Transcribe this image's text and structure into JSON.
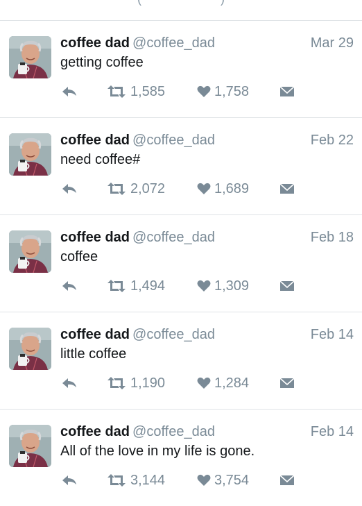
{
  "top_fragment": {
    "left": "(",
    "right": ")"
  },
  "colors": {
    "name": "#14171a",
    "meta": "#7a8a96",
    "divider": "#dfe3e6",
    "icon": "#7a8a96"
  },
  "tweets": [
    {
      "name": "coffee dad",
      "handle": "@coffee_dad",
      "date": "Mar 29",
      "text": "getting coffee",
      "retweets": "1,585",
      "likes": "1,758",
      "icons": [
        "reply-icon",
        "retweet-icon",
        "heart-icon",
        "envelope-icon"
      ]
    },
    {
      "name": "coffee dad",
      "handle": "@coffee_dad",
      "date": "Feb 22",
      "text": "need coffee#",
      "retweets": "2,072",
      "likes": "1,689",
      "icons": [
        "reply-icon",
        "retweet-icon",
        "heart-icon",
        "envelope-icon"
      ]
    },
    {
      "name": "coffee dad",
      "handle": "@coffee_dad",
      "date": "Feb 18",
      "text": "coffee",
      "retweets": "1,494",
      "likes": "1,309",
      "icons": [
        "reply-icon",
        "retweet-icon",
        "heart-icon",
        "envelope-icon"
      ]
    },
    {
      "name": "coffee dad",
      "handle": "@coffee_dad",
      "date": "Feb 14",
      "text": "little coffee",
      "retweets": "1,190",
      "likes": "1,284",
      "icons": [
        "reply-icon",
        "retweet-icon",
        "heart-icon",
        "envelope-icon"
      ]
    },
    {
      "name": "coffee dad",
      "handle": "@coffee_dad",
      "date": "Feb 14",
      "text": "All of the love in my life is gone.",
      "retweets": "3,144",
      "likes": "3,754",
      "icons": [
        "reply-icon",
        "retweet-icon",
        "heart-icon",
        "envelope-icon"
      ]
    }
  ]
}
